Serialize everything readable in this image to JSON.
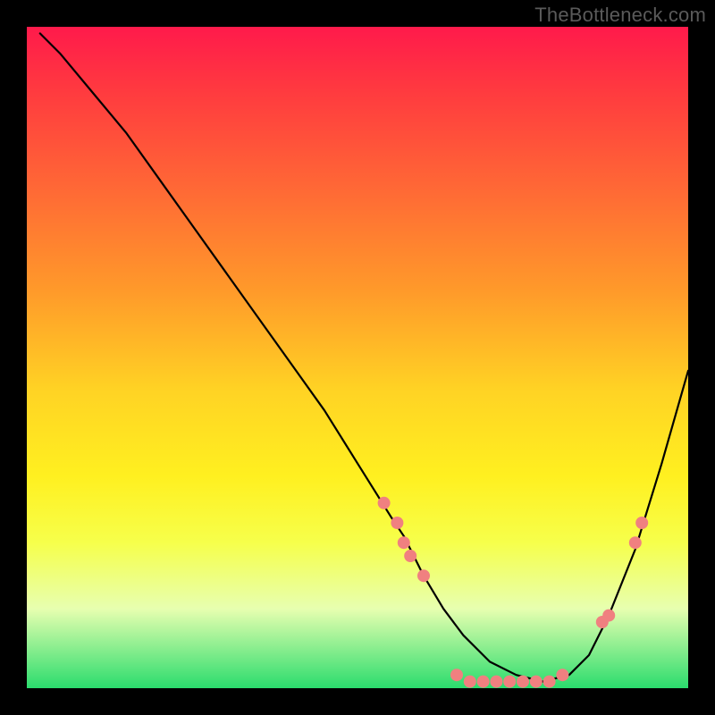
{
  "watermark": {
    "text": "TheBottleneck.com"
  },
  "colors": {
    "gradient_top": "#ff1a4b",
    "gradient_mid": "#fff020",
    "gradient_bottom": "#2bdc6d",
    "curve": "#000000",
    "marker": "#f08080"
  },
  "chart_data": {
    "type": "line",
    "title": "",
    "xlabel": "",
    "ylabel": "",
    "xlim": [
      0,
      100
    ],
    "ylim": [
      0,
      100
    ],
    "series": [
      {
        "name": "bottleneck-curve",
        "x": [
          2,
          5,
          10,
          15,
          20,
          25,
          30,
          35,
          40,
          45,
          50,
          55,
          57,
          60,
          63,
          66,
          70,
          74,
          78,
          82,
          85,
          88,
          92,
          96,
          100
        ],
        "values": [
          99,
          96,
          90,
          84,
          77,
          70,
          63,
          56,
          49,
          42,
          34,
          26,
          23,
          17,
          12,
          8,
          4,
          2,
          1,
          2,
          5,
          11,
          21,
          34,
          48
        ]
      }
    ],
    "markers": [
      {
        "x": 54,
        "y": 28
      },
      {
        "x": 56,
        "y": 25
      },
      {
        "x": 57,
        "y": 22
      },
      {
        "x": 58,
        "y": 20
      },
      {
        "x": 60,
        "y": 17
      },
      {
        "x": 65,
        "y": 2
      },
      {
        "x": 67,
        "y": 1
      },
      {
        "x": 69,
        "y": 1
      },
      {
        "x": 71,
        "y": 1
      },
      {
        "x": 73,
        "y": 1
      },
      {
        "x": 75,
        "y": 1
      },
      {
        "x": 77,
        "y": 1
      },
      {
        "x": 79,
        "y": 1
      },
      {
        "x": 81,
        "y": 2
      },
      {
        "x": 87,
        "y": 10
      },
      {
        "x": 88,
        "y": 11
      },
      {
        "x": 92,
        "y": 22
      },
      {
        "x": 93,
        "y": 25
      }
    ]
  }
}
